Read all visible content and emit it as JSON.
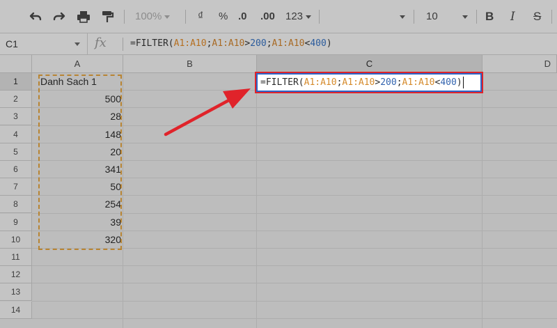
{
  "toolbar": {
    "zoom": "100%",
    "currency": "₫",
    "percent": "%",
    "dec_decrease": ".0",
    "dec_increase": ".00",
    "number_format": "123",
    "font_size": "10",
    "bold": "B",
    "italic": "I",
    "strike": "S"
  },
  "formula_bar": {
    "name_box": "C1",
    "fx": "fx",
    "formula": {
      "prefix": "=FILTER(",
      "ref1": "A1:A10",
      "sep1": ";",
      "ref2": "A1:A10",
      "op1": ">",
      "num1": "200",
      "sep2": ";",
      "ref3": "A1:A10",
      "op2": "<",
      "num2": "400",
      "suffix": ")"
    }
  },
  "columns": [
    "A",
    "B",
    "C",
    "D"
  ],
  "rows": [
    "1",
    "2",
    "3",
    "4",
    "5",
    "6",
    "7",
    "8",
    "9",
    "10",
    "11",
    "12",
    "13",
    "14"
  ],
  "column_a": [
    "Danh Sach 1",
    "500",
    "28",
    "148",
    "20",
    "341",
    "50",
    "254",
    "39",
    "320"
  ],
  "selected_cell": "C1",
  "colors": {
    "highlight_border": "#e0232a",
    "arrow": "#e0232a",
    "range_dash": "#b88432",
    "cell_border": "#2a64c8"
  }
}
